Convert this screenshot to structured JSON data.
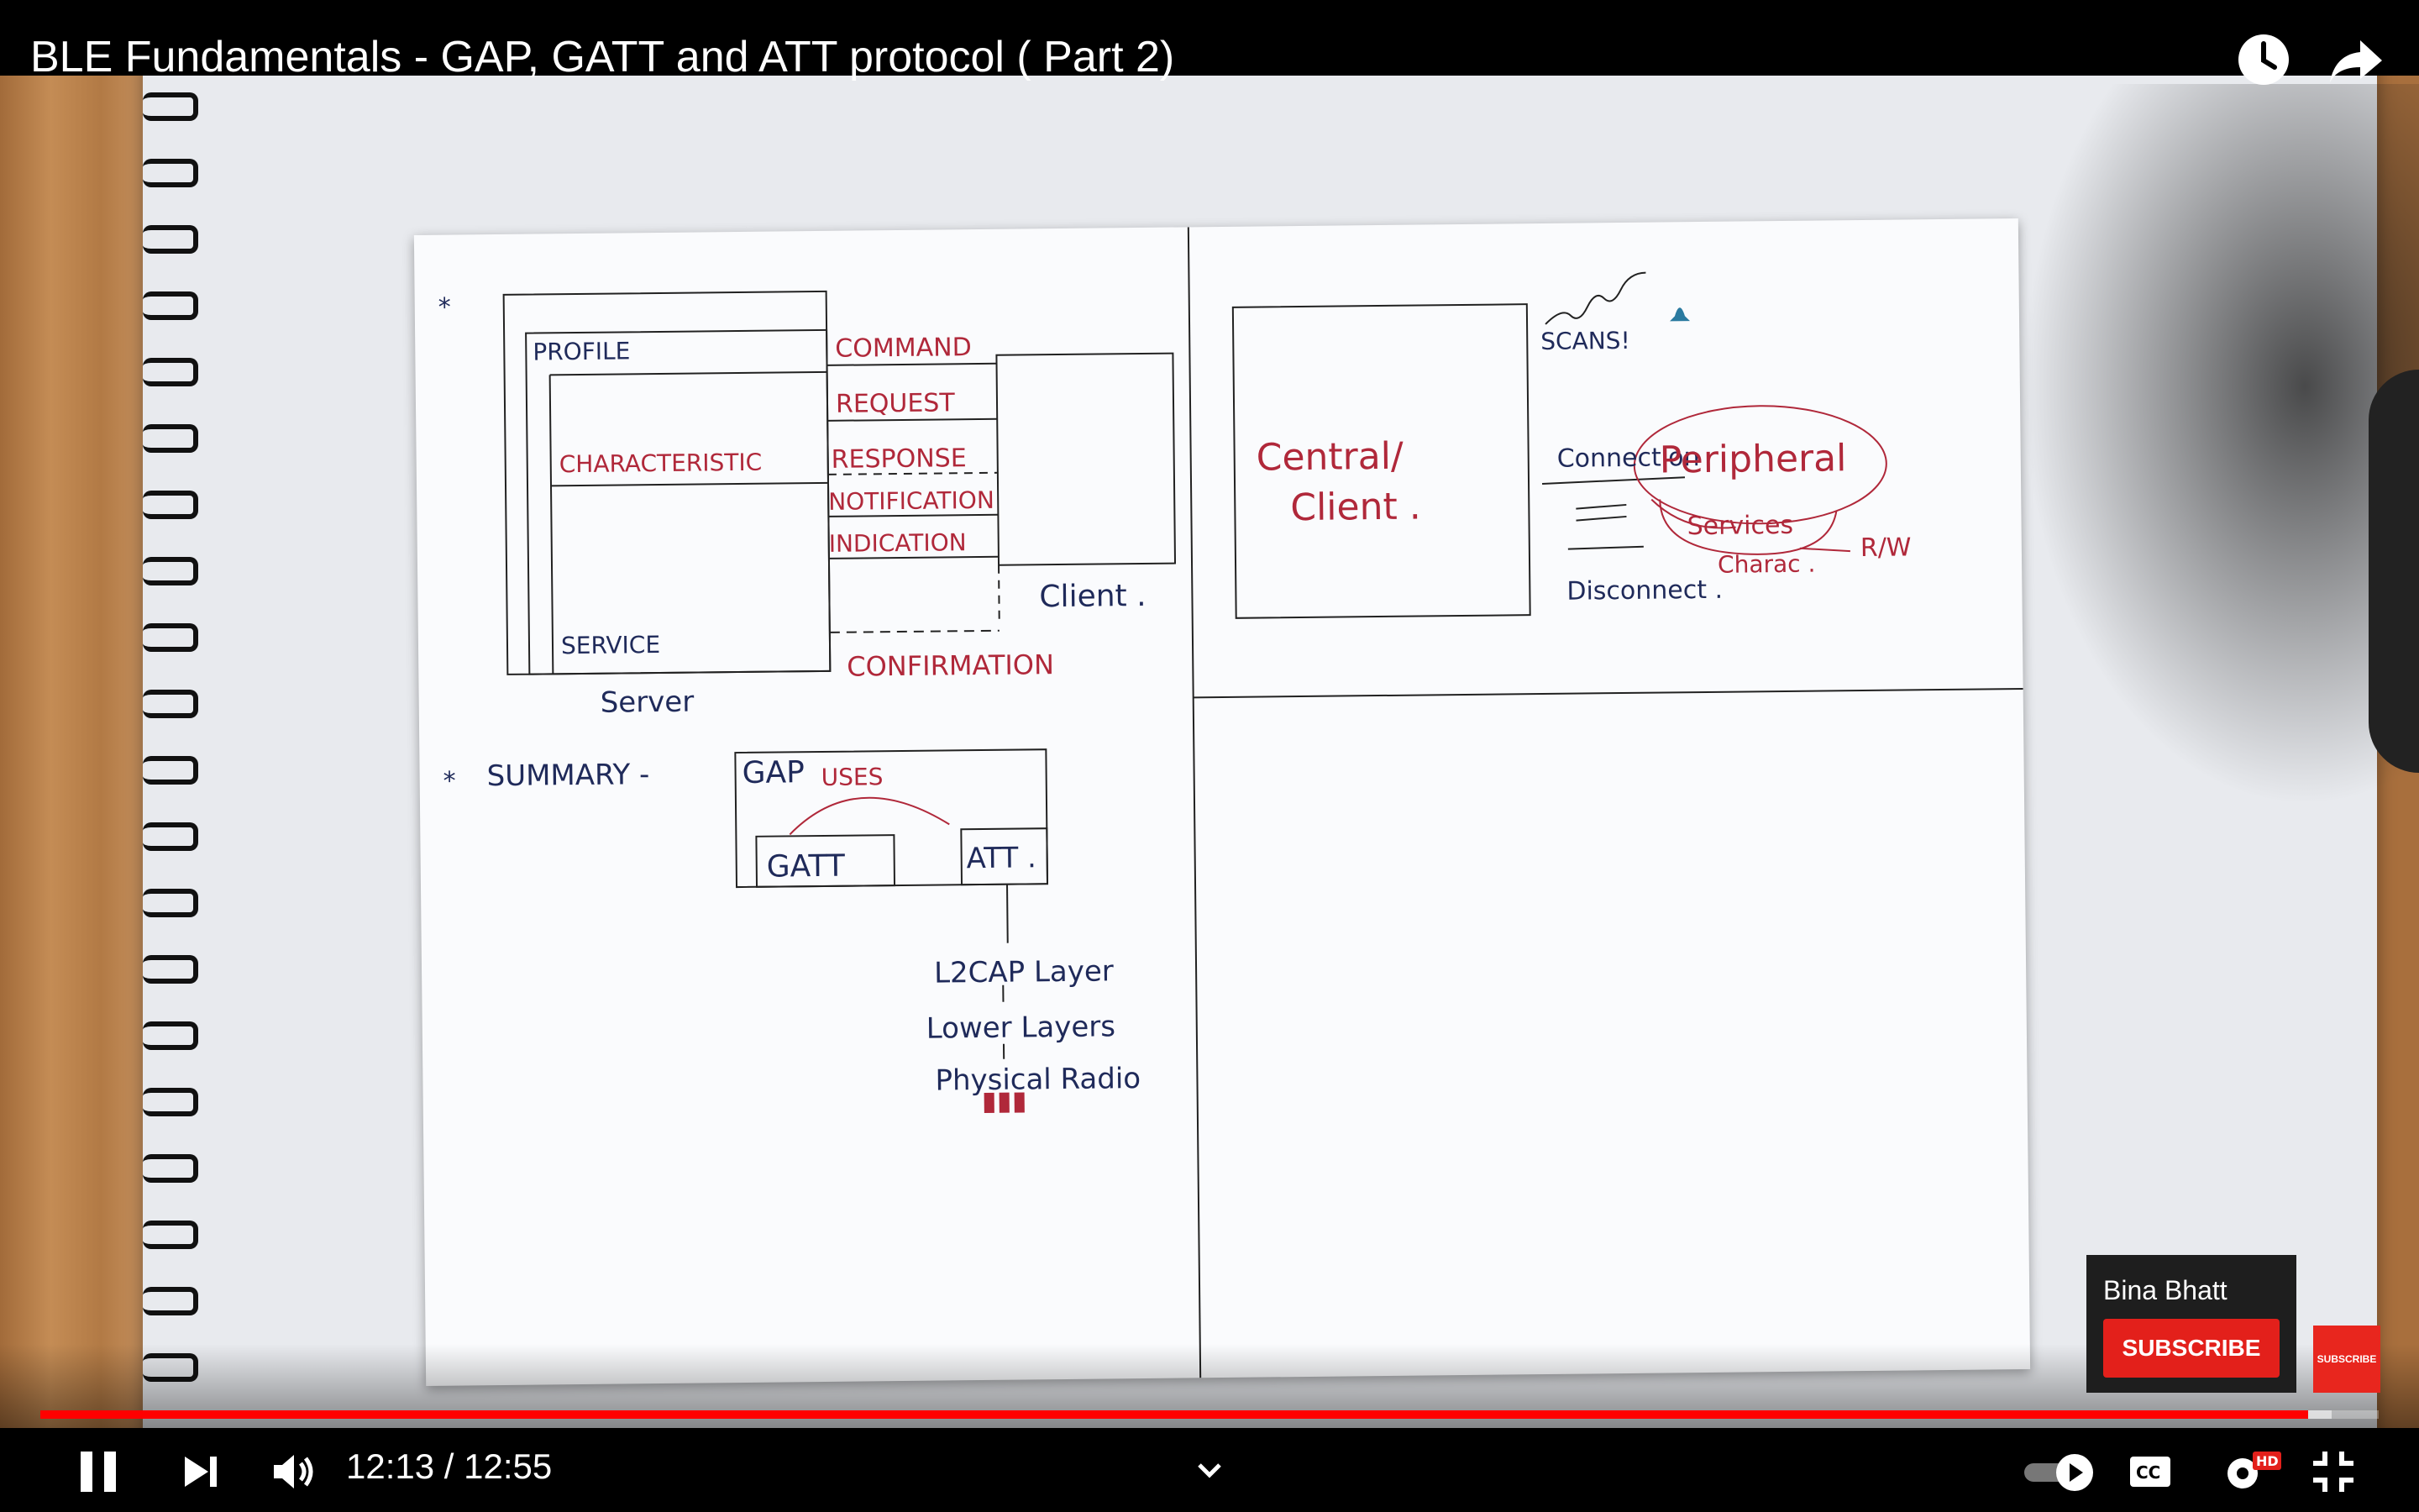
{
  "video": {
    "title": "BLE Fundamentals - GAP, GATT and ATT protocol ( Part 2)",
    "progress_fraction": 0.97,
    "buffered_fraction": 0.98
  },
  "whiteboard": {
    "star": "*",
    "profile": "PROFILE",
    "characteristic": "CHARACTERISTIC",
    "service": "SERVICE",
    "server": "Server",
    "command": "COMMAND",
    "request": "REQUEST",
    "response": "RESPONSE",
    "notification": "NOTIFICATION",
    "indication": "INDICATION",
    "confirmation": "CONFIRMATION",
    "client": "Client .",
    "summary": "SUMMARY -",
    "gap": "GAP",
    "uses": "USES",
    "gatt": "GATT",
    "att": "ATT .",
    "l2cap": "L2CAP Layer",
    "lower_layers": "Lower Layers",
    "physical_radio": "Physical Radio",
    "central_client_1": "Central/",
    "central_client_2": "Client .",
    "scans": "SCANS!",
    "connection": "Connection",
    "disconnect": "Disconnect .",
    "peripheral": "Peripheral",
    "services": "Services",
    "charac": "Charac .",
    "rw": "R/W"
  },
  "controls": {
    "current_time": "12:13",
    "duration": "12:55",
    "time_display": "12:13 / 12:55",
    "hd_badge": "HD"
  },
  "channel_card": {
    "name": "Bina Bhatt",
    "subscribe_label": "SUBSCRIBE",
    "badge_label": "SUBSCRIBE"
  },
  "colors": {
    "progress_played": "#ff0000",
    "subscribe": "#e3201b",
    "ink_blue": "#1f2a5a",
    "ink_red": "#b0283a"
  }
}
